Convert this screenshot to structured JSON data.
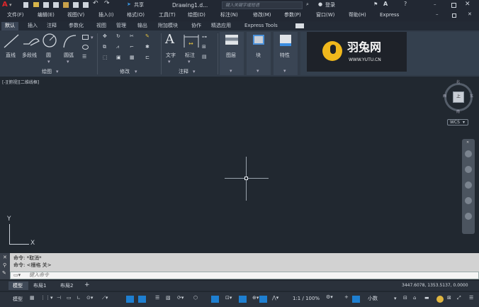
{
  "title": {
    "share": "共享",
    "doc": "Drawing1.d...",
    "search_placeholder": "键入关键字或短语",
    "login": "登录"
  },
  "menu": [
    "文件(F)",
    "编辑(E)",
    "视图(V)",
    "插入(I)",
    "格式(O)",
    "工具(T)",
    "绘图(D)",
    "标注(N)",
    "修改(M)",
    "参数(P)",
    "窗口(W)",
    "帮助(H)",
    "Express"
  ],
  "tabs": [
    "默认",
    "插入",
    "注释",
    "参数化",
    "视图",
    "管理",
    "输出",
    "附加模块",
    "协作",
    "精选应用",
    "Express Tools"
  ],
  "ribbon": {
    "line": "直线",
    "polyline": "多段线",
    "circle": "圆",
    "arc": "圆弧",
    "text": "文字",
    "dim": "标注",
    "layer": "图层",
    "block": "块",
    "props": "特性",
    "groups": [
      "绘图",
      "修改",
      "注释"
    ]
  },
  "watermark": {
    "name": "羽兔网",
    "url": "WWW.YUTU.CN"
  },
  "viewport": {
    "label": "[-][俯视][二维线框]",
    "axis_y": "Y",
    "axis_x": "X",
    "compass": {
      "n": "北",
      "s": "南",
      "e": "东",
      "w": "西",
      "top": "上"
    },
    "wcs": "WCS"
  },
  "cmd": {
    "line1": "命令: *取消*",
    "line2": "命令:  <栅格 关>",
    "input_placeholder": "键入命令"
  },
  "layouts": [
    "模型",
    "布局1",
    "布局2",
    "+"
  ],
  "status": {
    "coords": "3447.6078, 1353.5137, 0.0000",
    "model": "模型",
    "scale": "1:1 / 100%",
    "units": "小数"
  },
  "colors": {
    "accent": "#1e90e6",
    "bg": "#212830"
  }
}
